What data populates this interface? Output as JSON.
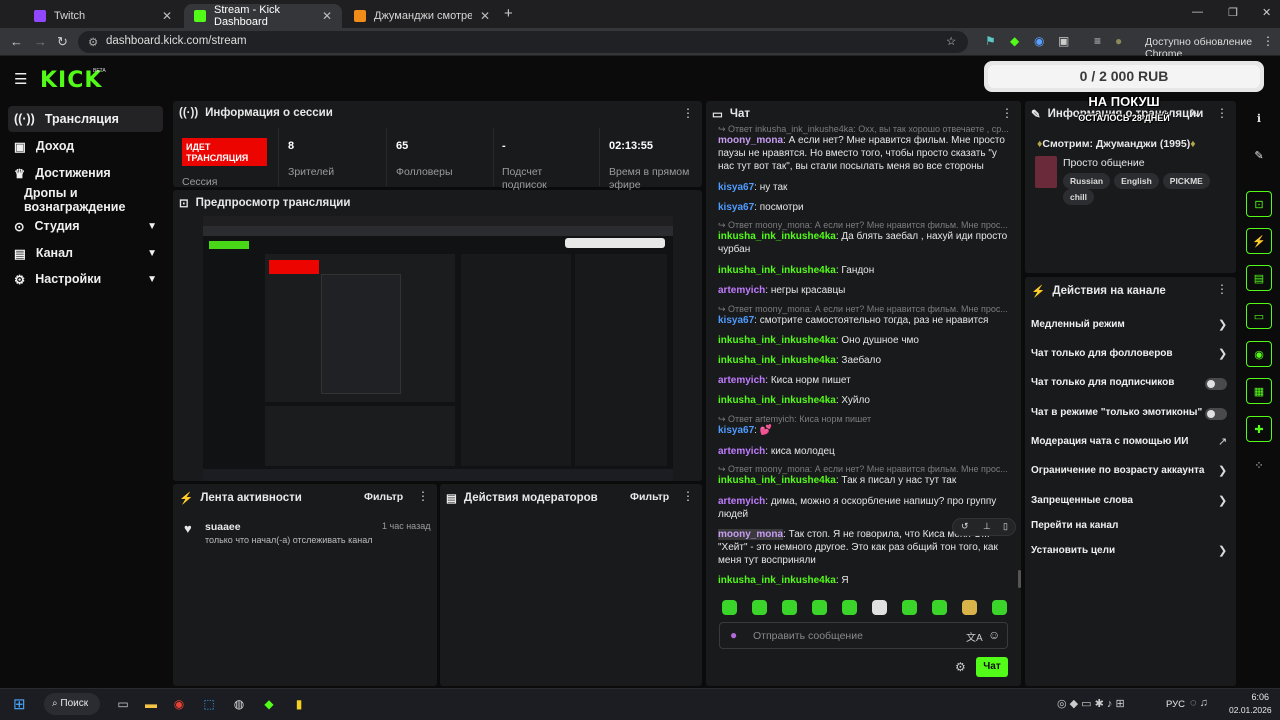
{
  "browser": {
    "tabs": [
      {
        "label": "Twitch",
        "close": "✕"
      },
      {
        "label": "Stream - Kick Dashboard",
        "close": "✕"
      },
      {
        "label": "Джуманджи смотреть онлайн",
        "close": "✕"
      }
    ],
    "new_tab": "+",
    "url": "dashboard.kick.com/stream",
    "update_label": "Доступно обновление Chrome"
  },
  "kick": {
    "logo": "KICK",
    "beta": "BETA",
    "goal": "0 / 2 000 RUB",
    "overlay_line1": "НА ПОКУШ",
    "overlay_line2": "ОСТАЛОСЬ 28 ДНЕЙ"
  },
  "sidebar": {
    "items": [
      {
        "label": "Трансляция",
        "icon": "broadcast-icon"
      },
      {
        "label": "Доход",
        "icon": "money-icon"
      },
      {
        "label": "Достижения",
        "icon": "trophy-icon"
      },
      {
        "label": "Дропы и вознаграждение"
      },
      {
        "label": "Студия",
        "icon": "studio-icon"
      },
      {
        "label": "Канал",
        "icon": "channel-icon"
      },
      {
        "label": "Настройки",
        "icon": "gear-icon"
      }
    ]
  },
  "session": {
    "title": "Информация о сессии",
    "live_label": "ИДЕТ ТРАНСЛЯЦИЯ",
    "session_label": "Сессия",
    "stats": [
      {
        "value": "8",
        "label": "Зрителей"
      },
      {
        "value": "65",
        "label": "Фолловеры"
      },
      {
        "value": "-",
        "label": "Подсчет подписок"
      },
      {
        "value": "02:13:55",
        "label": "Время в прямом эфире"
      }
    ]
  },
  "preview": {
    "title": "Предпросмотр трансляции"
  },
  "activity": {
    "title": "Лента активности",
    "filter": "Фильтр",
    "items": [
      {
        "user": "suaaee",
        "text": "только что начал(-а) отслеживать канал",
        "time": "1 час назад"
      }
    ]
  },
  "mod_actions": {
    "title": "Действия модераторов",
    "filter": "Фильтр"
  },
  "chat": {
    "title": "Чат",
    "messages": [
      {
        "reply": "Ответ inkusha_ink_inkushe4ka: Охх, вы так хорошо отвечаете , ср..."
      },
      {
        "user": "moony_mona",
        "color": "#c89cf2",
        "text": "А если нет? Мне нравится фильм. Мне просто паузы не нравятся. Но вместо того, чтобы просто сказать \"у нас тут вот так\", вы стали посылать меня во все стороны"
      },
      {
        "user": "kisya67",
        "color": "#4f9cff",
        "text": "ну так"
      },
      {
        "user": "kisya67",
        "color": "#4f9cff",
        "text": "посмотри"
      },
      {
        "reply": "Ответ moony_mona: А если нет? Мне нравится фильм. Мне прос..."
      },
      {
        "user": "inkusha_ink_inkushe4ka",
        "color": "#53fc18",
        "text": "Да блять заебал , нахуй иди просто чурбан"
      },
      {
        "user": "inkusha_ink_inkushe4ka",
        "color": "#53fc18",
        "text": "Гандон"
      },
      {
        "user": "artemyich",
        "color": "#c07cff",
        "text": "негры красавцы"
      },
      {
        "reply": "Ответ moony_mona: А если нет? Мне нравится фильм. Мне прос..."
      },
      {
        "user": "kisya67",
        "color": "#4f9cff",
        "text": "смотрите самостоятельно тогда, раз не нравится"
      },
      {
        "user": "inkusha_ink_inkushe4ka",
        "color": "#53fc18",
        "text": "Оно душное чмо"
      },
      {
        "user": "inkusha_ink_inkushe4ka",
        "color": "#53fc18",
        "text": "Заебало"
      },
      {
        "user": "artemyich",
        "color": "#c07cff",
        "text": "Киса норм пишет"
      },
      {
        "user": "inkusha_ink_inkushe4ka",
        "color": "#53fc18",
        "text": "Хуйло"
      },
      {
        "reply": "Ответ artemyich: Киса норм пишет"
      },
      {
        "user": "kisya67",
        "color": "#4f9cff",
        "text": "💕"
      },
      {
        "user": "artemyich",
        "color": "#c07cff",
        "text": "киса молодец"
      },
      {
        "reply": "Ответ moony_mona: А если нет? Мне нравится фильм. Мне прос..."
      },
      {
        "user": "inkusha_ink_inkushe4ka",
        "color": "#53fc18",
        "text": "Так я писал у нас тут так"
      },
      {
        "user": "artemyich",
        "color": "#c07cff",
        "text": "дима, можно я оскорбление напишу? про группу людей"
      },
      {
        "user": "moony_mona",
        "color": "#c89cf2",
        "text": "Так стоп. Я не говорила, что Киса меня О... \"Хейт\" - это немного другое. Это как раз общий тон того, как меня тут восприняли"
      },
      {
        "user": "inkusha_ink_inkushe4ka",
        "color": "#53fc18",
        "text": "Я"
      }
    ],
    "placeholder": "Отправить сообщение",
    "send": "Чат"
  },
  "stream_info": {
    "title": "Информация о трансляции",
    "watching": "Смотрим: Джуманджи (1995)",
    "category": "Просто общение",
    "tags": [
      "Russian",
      "English",
      "PICKME",
      "chill"
    ]
  },
  "channel_actions": {
    "title": "Действия на канале",
    "items": [
      {
        "label": "Медленный режим",
        "control": "chevron"
      },
      {
        "label": "Чат только для фолловеров",
        "control": "chevron"
      },
      {
        "label": "Чат только для подписчиков",
        "control": "toggle"
      },
      {
        "label": "Чат в режиме \"только эмотиконы\"",
        "control": "toggle"
      },
      {
        "label": "Модерация чата с помощью ИИ",
        "control": "external"
      },
      {
        "label": "Ограничение по возрасту аккаунта",
        "control": "chevron"
      },
      {
        "label": "Запрещенные слова",
        "control": "chevron"
      },
      {
        "label": "Перейти на канал",
        "control": "none"
      },
      {
        "label": "Установить цели",
        "control": "chevron"
      }
    ]
  },
  "taskbar": {
    "search": "Поиск",
    "lang": "РУС",
    "time": "6:06",
    "date": "02.01.2026"
  },
  "colors": {
    "accent": "#53fc18",
    "live": "#eb0400",
    "panel": "#191a1c"
  }
}
